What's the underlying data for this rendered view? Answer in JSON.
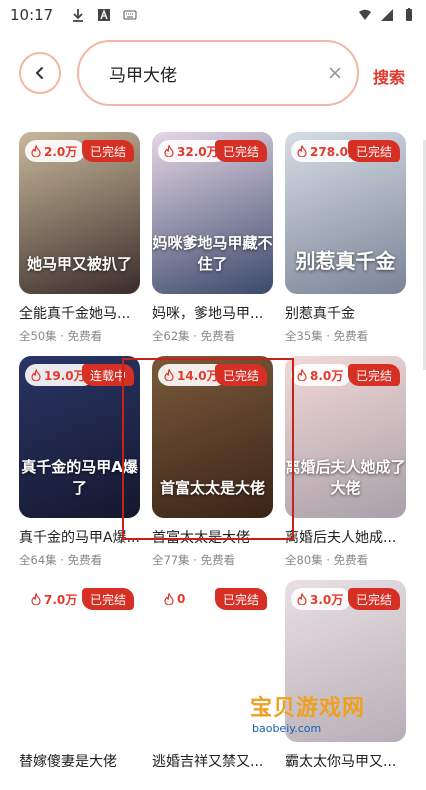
{
  "status_bar": {
    "time": "10:17"
  },
  "search": {
    "query": "马甲大佬",
    "submit_label": "搜索"
  },
  "results": [
    {
      "heat": "2.0万",
      "status": "已完结",
      "title": "全能真千金她马...",
      "meta": "全50集 · 免费看",
      "poster_text": "她马甲又被扒了",
      "colors": [
        "#c9b89c",
        "#3a2d2a"
      ]
    },
    {
      "heat": "32.0万",
      "status": "已完结",
      "title": "妈咪，爹地马甲...",
      "meta": "全62集 · 免费看",
      "poster_text": "妈咪爹地马甲藏不住了",
      "colors": [
        "#e6d7e8",
        "#3b4a6a"
      ]
    },
    {
      "heat": "278.0万",
      "status": "已完结",
      "title": "别惹真千金",
      "meta": "全35集 · 免费看",
      "poster_text": "别惹真千金",
      "colors": [
        "#d6dde6",
        "#7a8496"
      ]
    },
    {
      "heat": "19.0万",
      "status": "连载中",
      "title": "真千金的马甲A爆...",
      "meta": "全64集 · 免费看",
      "poster_text": "真千金的马甲A爆了",
      "colors": [
        "#2a3566",
        "#14182e"
      ]
    },
    {
      "heat": "14.0万",
      "status": "已完结",
      "title": "首富太太是大佬",
      "meta": "全77集 · 免费看",
      "poster_text": "首富太太是大佬",
      "colors": [
        "#7a5a3a",
        "#3a2418"
      ]
    },
    {
      "heat": "8.0万",
      "status": "已完结",
      "title": "离婚后夫人她成...",
      "meta": "全80集 · 免费看",
      "poster_text": "离婚后夫人她成了大佬",
      "colors": [
        "#f3d8d8",
        "#a8a0a8"
      ]
    },
    {
      "heat": "7.0万",
      "status": "已完结",
      "title": "替嫁傻妻是大佬",
      "meta": "",
      "poster_text": "",
      "colors": [
        "#ffffff",
        "#ffffff"
      ]
    },
    {
      "heat": "0",
      "status": "已完结",
      "title": "逃婚吉祥又禁又...",
      "meta": "",
      "poster_text": "",
      "colors": [
        "#ffffff",
        "#ffffff"
      ]
    },
    {
      "heat": "3.0万",
      "status": "已完结",
      "title": "霸太太你马甲又...",
      "meta": "",
      "poster_text": "",
      "colors": [
        "#e8e0e4",
        "#b8aeb6"
      ]
    }
  ],
  "watermark": {
    "title": "宝贝游戏网",
    "url": "baobeiy.com"
  }
}
